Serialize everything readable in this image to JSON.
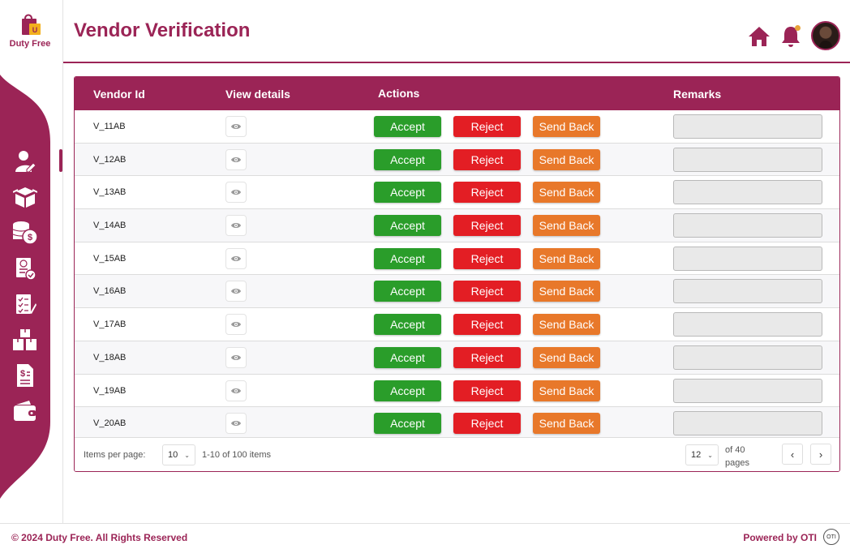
{
  "brand": {
    "name": "Duty Free",
    "logo_letter": "U",
    "primary_color": "#9b2456"
  },
  "sidebar": {
    "items": [
      {
        "icon": "user-edit-icon",
        "active": true
      },
      {
        "icon": "boxes-icon",
        "active": false
      },
      {
        "icon": "coins-dollar-icon",
        "active": false
      },
      {
        "icon": "invoice-check-icon",
        "active": false
      },
      {
        "icon": "checklist-icon",
        "active": false
      },
      {
        "icon": "inventory-boxes-icon",
        "active": false
      },
      {
        "icon": "dollar-document-icon",
        "active": false
      },
      {
        "icon": "wallet-icon",
        "active": false
      }
    ]
  },
  "header": {
    "title": "Vendor Verification",
    "icons": [
      "home-icon",
      "bell-icon",
      "avatar"
    ],
    "notification_dot_color": "#e8a23a"
  },
  "table": {
    "columns": {
      "vendor_id": "Vendor Id",
      "view_details": "View details",
      "actions": "Actions",
      "remarks": "Remarks"
    },
    "actions": {
      "accept": "Accept",
      "reject": "Reject",
      "send_back": "Send Back"
    },
    "action_colors": {
      "accept": "#2a9d2a",
      "reject": "#e31e24",
      "send_back": "#e8782a"
    },
    "rows": [
      {
        "vendor_id": "V_11AB",
        "remarks": ""
      },
      {
        "vendor_id": "V_12AB",
        "remarks": ""
      },
      {
        "vendor_id": "V_13AB",
        "remarks": ""
      },
      {
        "vendor_id": "V_14AB",
        "remarks": ""
      },
      {
        "vendor_id": "V_15AB",
        "remarks": ""
      },
      {
        "vendor_id": "V_16AB",
        "remarks": ""
      },
      {
        "vendor_id": "V_17AB",
        "remarks": ""
      },
      {
        "vendor_id": "V_18AB",
        "remarks": ""
      },
      {
        "vendor_id": "V_19AB",
        "remarks": ""
      },
      {
        "vendor_id": "V_20AB",
        "remarks": ""
      }
    ]
  },
  "pagination": {
    "items_per_page_label": "Items per page:",
    "items_per_page": "10",
    "range_text": "1-10 of 100 items",
    "current_page": "12",
    "of_pages_text": "of 40 pages",
    "prev": "‹",
    "next": "›"
  },
  "footer": {
    "copyright": "© 2024 Duty Free. All Rights Reserved",
    "powered_by": "Powered by OTI",
    "oti_logo": "OTI"
  }
}
